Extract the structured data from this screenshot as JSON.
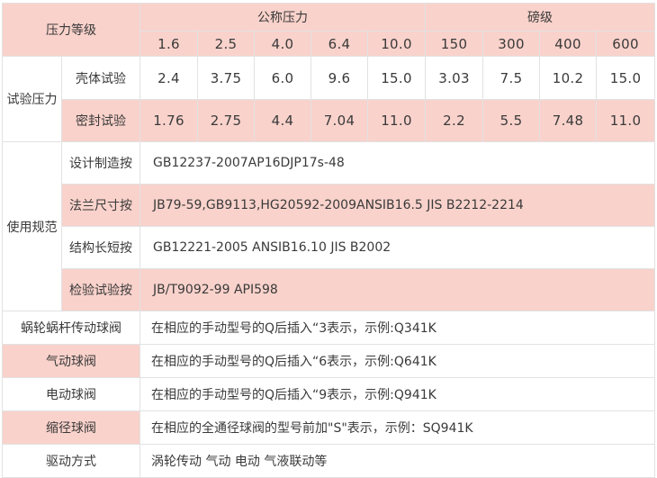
{
  "header": {
    "pressure_grade": "压力等级",
    "nominal_pressure": "公称压力",
    "pound_class": "磅级",
    "nominal_values": [
      "1.6",
      "2.5",
      "4.0",
      "6.4",
      "10.0"
    ],
    "pound_values": [
      "150",
      "300",
      "400",
      "600"
    ]
  },
  "test_pressure": {
    "label": "试验压力",
    "rows": [
      {
        "label": "壳体试验",
        "values": [
          "2.4",
          "3.75",
          "6.0",
          "9.6",
          "15.0",
          "3.03",
          "7.5",
          "10.2",
          "15.0"
        ]
      },
      {
        "label": "密封试验",
        "values": [
          "1.76",
          "2.75",
          "4.4",
          "7.04",
          "11.0",
          "2.2",
          "5.5",
          "7.48",
          "11.0"
        ]
      }
    ]
  },
  "usage_spec": {
    "label": "使用规范",
    "rows": [
      {
        "label": "设计制造按",
        "value": "GB12237-2007AP16DJP17s-48"
      },
      {
        "label": "法兰尺寸按",
        "value": "JB79-59,GB9113,HG20592-2009ANSIB16.5 JIS B2212-2214"
      },
      {
        "label": "结构长短按",
        "value": "GB12221-2005 ANSIB16.10 JIS B2002"
      },
      {
        "label": "检验试验按",
        "value": "JB/T9092-99 API598"
      }
    ]
  },
  "valve_types": [
    {
      "label": "蜗轮蜗杆传动球阀",
      "value": "在相应的手动型号的Q后插入“3表示，示例:Q341K"
    },
    {
      "label": "气动球阀",
      "value": "在相应的手动型号的Q后插入“6表示，示例:Q641K"
    },
    {
      "label": "电动球阀",
      "value": "在相应的手动型号的Q后插入“9表示，示例:Q941K"
    },
    {
      "label": "缩径球阀",
      "value": "在相应的全通径球阀的型号前加\"S\"表示，示例：SQ941K"
    },
    {
      "label": "驱动方式",
      "value": "涡轮传动 气动 电动 气液联动等"
    }
  ],
  "colors": {
    "pink": "#f9d2cb",
    "white": "#ffffff",
    "border": "#e2e2e2",
    "text": "#3a3a3a"
  }
}
